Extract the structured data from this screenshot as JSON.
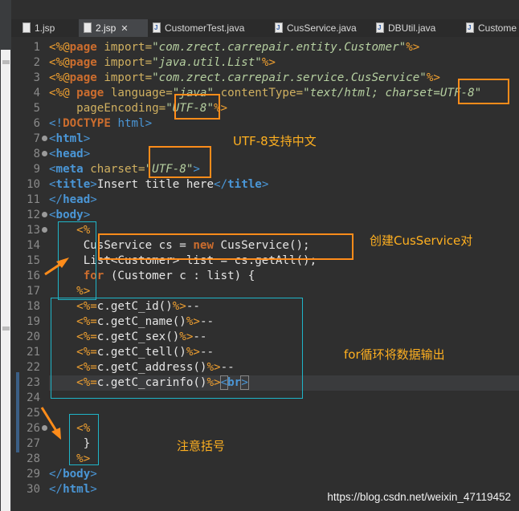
{
  "tabs": [
    {
      "label": "1.jsp"
    },
    {
      "label": "2.jsp",
      "close": "✕"
    },
    {
      "label": "CustomerTest.java"
    },
    {
      "label": "CusService.java"
    },
    {
      "label": "DBUtil.java"
    },
    {
      "label": "Custome"
    }
  ],
  "line_numbers": [
    "1",
    "2",
    "3",
    "4",
    "5",
    "6",
    "7",
    "8",
    "9",
    "10",
    "11",
    "12",
    "13",
    "14",
    "15",
    "16",
    "17",
    "18",
    "19",
    "20",
    "21",
    "22",
    "23",
    "24",
    "25",
    "26",
    "27",
    "28",
    "29",
    "30"
  ],
  "code": {
    "l1": [
      "<%@",
      "page",
      "import=",
      "\"com.zrect.carrepair.entity.Customer\"",
      "%>"
    ],
    "l2": [
      "<%@",
      "page",
      "import=",
      "\"java.util.List\"",
      "%>"
    ],
    "l3": [
      "<%@",
      "page",
      "import=",
      "\"com.zrect.carrepair.service.CusService\"",
      "%>"
    ],
    "l4": [
      "<%@",
      "page",
      "language=",
      "\"java\"",
      "contentType=",
      "\"text/html; charset=",
      "UTF-8\""
    ],
    "l5": [
      "pageEncoding=",
      "\"UTF-8\"",
      "%>"
    ],
    "l6": [
      "<!",
      "DOCTYPE",
      "html",
      ">"
    ],
    "l7": [
      "<",
      "html",
      ">"
    ],
    "l8": [
      "<",
      "head",
      ">"
    ],
    "l9": [
      "<",
      "meta",
      "charset=",
      "\"UTF-8\"",
      ">"
    ],
    "l10": [
      "<",
      "title",
      ">",
      "Insert title here",
      "</",
      "title",
      ">"
    ],
    "l11": [
      "</",
      "head",
      ">"
    ],
    "l12": [
      "<",
      "body",
      ">"
    ],
    "l13": [
      "<%"
    ],
    "l14": [
      "CusService cs = ",
      "new",
      " CusService();"
    ],
    "l15": [
      "List<Customer> list = cs.getAll();"
    ],
    "l16": [
      "for",
      " (Customer c : list) {"
    ],
    "l17": [
      "%>"
    ],
    "l18": [
      "<%=",
      "c.getC_id()",
      "%>",
      "--"
    ],
    "l19": [
      "<%=",
      "c.getC_name()",
      "%>",
      "--"
    ],
    "l20": [
      "<%=",
      "c.getC_sex()",
      "%>",
      "--"
    ],
    "l21": [
      "<%=",
      "c.getC_tell()",
      "%>",
      "--"
    ],
    "l22": [
      "<%=",
      "c.getC_address()",
      "%>",
      "--"
    ],
    "l23": [
      "<%=",
      "c.getC_carinfo()",
      "%>",
      "<",
      "br",
      ">"
    ],
    "l26": [
      "<%"
    ],
    "l27": [
      "}"
    ],
    "l28": [
      "%>"
    ],
    "l29": [
      "</",
      "body",
      ">"
    ],
    "l30": [
      "</",
      "html",
      ">"
    ]
  },
  "annotations": {
    "utf8": "UTF-8支持中文",
    "create": "创建CusService对",
    "loop": "for循环将数据输出",
    "bracket": "注意括号"
  },
  "watermark": "https://blog.csdn.net/weixin_47119452",
  "colors": {
    "annotation": "#ffb020",
    "highlight_box": "#ff8c1a",
    "region_box": "#1fb5c8",
    "directive": "#f0a030",
    "tag": "#4a96d6",
    "attribute": "#d0b060",
    "string": "#b5cfa0",
    "keyword": "#cc6d2e"
  }
}
